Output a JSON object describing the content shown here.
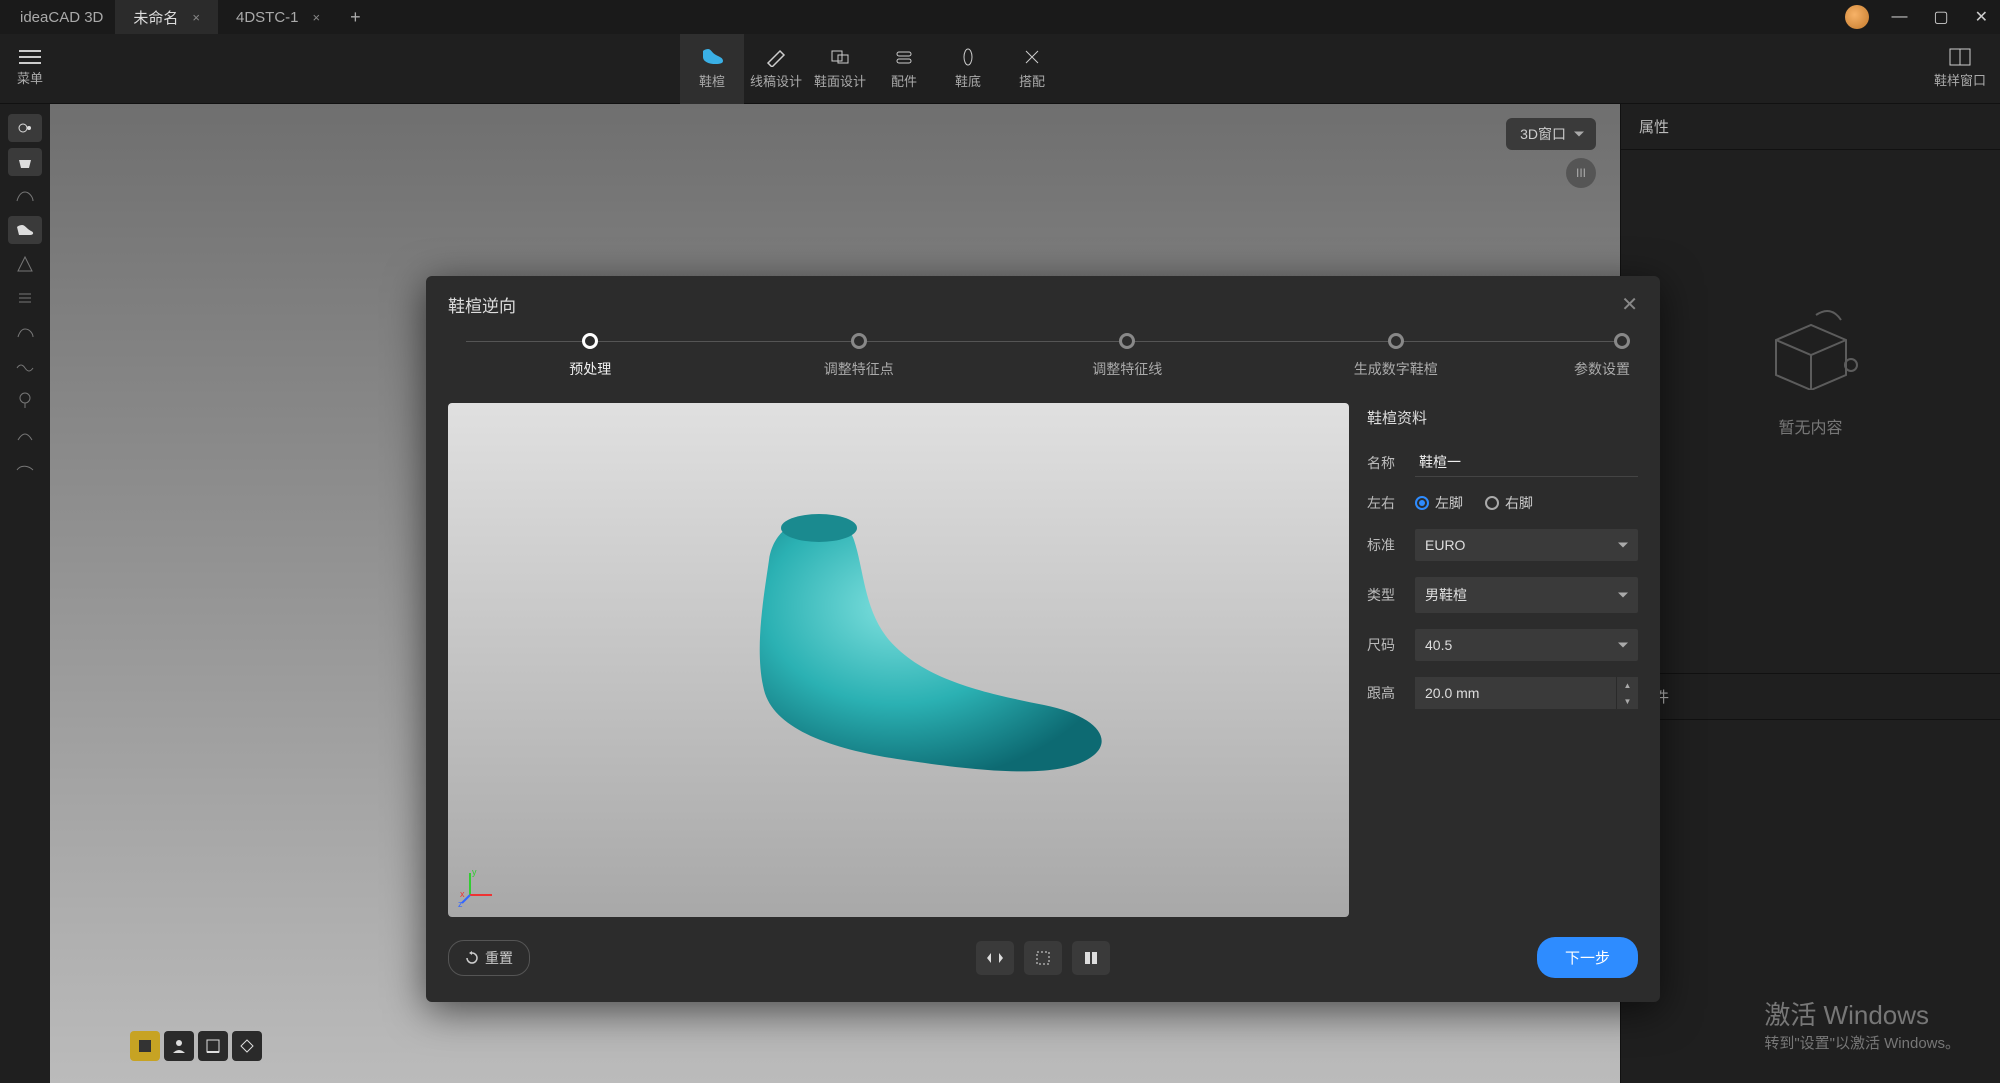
{
  "app": {
    "name": "ideaCAD 3D"
  },
  "tabs": [
    {
      "label": "未命名",
      "active": true
    },
    {
      "label": "4DSTC-1",
      "active": false
    }
  ],
  "menu_label": "菜单",
  "toolbar": {
    "items": [
      {
        "id": "last",
        "label": "鞋楦",
        "active": true
      },
      {
        "id": "line",
        "label": "线稿设计"
      },
      {
        "id": "design",
        "label": "鞋面设计"
      },
      {
        "id": "parts",
        "label": "配件"
      },
      {
        "id": "sole",
        "label": "鞋底"
      },
      {
        "id": "match",
        "label": "搭配"
      }
    ],
    "right_label": "鞋样窗口"
  },
  "viewport": {
    "dropdown_label": "3D窗口",
    "corner_badge": "III"
  },
  "right_panel": {
    "properties_title": "属性",
    "empty_text": "暂无内容",
    "parts_title": "部件"
  },
  "dialog": {
    "title": "鞋楦逆向",
    "steps": [
      {
        "label": "预处理",
        "active": true
      },
      {
        "label": "调整特征点"
      },
      {
        "label": "调整特征线"
      },
      {
        "label": "生成数字鞋楦"
      },
      {
        "label": "参数设置"
      }
    ],
    "form": {
      "section_title": "鞋楦资料",
      "name_label": "名称",
      "name_value": "鞋楦一",
      "side_label": "左右",
      "side_left": "左脚",
      "side_right": "右脚",
      "side_selected": "left",
      "standard_label": "标准",
      "standard_value": "EURO",
      "type_label": "类型",
      "type_value": "男鞋楦",
      "size_label": "尺码",
      "size_value": "40.5",
      "heel_label": "跟高",
      "heel_value": "20.0 mm"
    },
    "reset_label": "重置",
    "next_label": "下一步"
  },
  "watermark": {
    "line1": "激活 Windows",
    "line2": "转到\"设置\"以激活 Windows。"
  }
}
